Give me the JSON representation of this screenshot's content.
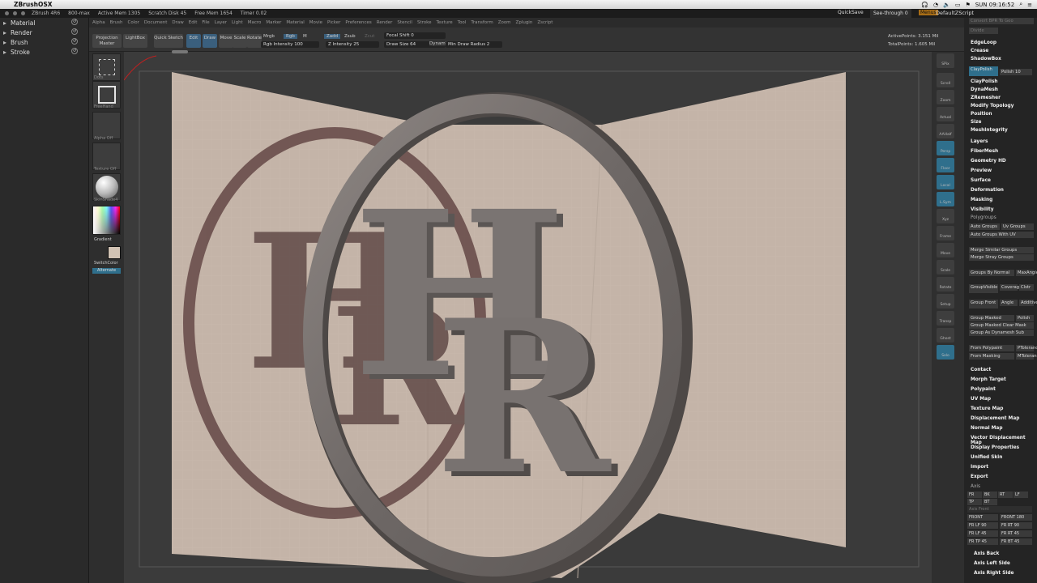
{
  "macbar": {
    "app_name": "ZBrushOSX",
    "clock": "SUN 09:16:52"
  },
  "statusbar": {
    "version": "ZBrush 4R6",
    "mem": "800-max",
    "active_mem": "Active Mem 1305",
    "scratch": "Scratch Disk 45",
    "free_mem": "Free Mem 1654",
    "timer": "Timer 0.02",
    "quicksave": "QuickSave",
    "see_through": "See-through  0",
    "menus": "Menus",
    "default_script": "DefaultZScript"
  },
  "leftpanel": {
    "items": [
      {
        "label": "Material"
      },
      {
        "label": "Render"
      },
      {
        "label": "Brush"
      },
      {
        "label": "Stroke"
      }
    ]
  },
  "topmenu": [
    "Alpha",
    "Brush",
    "Color",
    "Document",
    "Draw",
    "Edit",
    "File",
    "Layer",
    "Light",
    "Macro",
    "Marker",
    "Material",
    "Movie",
    "Picker",
    "Preferences",
    "Render",
    "Stencil",
    "Stroke",
    "Texture",
    "Tool",
    "Transform",
    "Zoom",
    "Zplugin",
    "Zscript"
  ],
  "toolbar": {
    "projection_master": "Projection Master",
    "lightbox": "LightBox",
    "quick_sketch": "Quick Sketch",
    "edit": "Edit",
    "draw": "Draw",
    "move": "Move",
    "scale": "Scale",
    "rotate": "Rotate",
    "mrgb": "Mrgb",
    "rgb": "Rgb",
    "m": "M",
    "rgb_intensity": "Rgb Intensity 100",
    "zadd": "Zadd",
    "zsub": "Zsub",
    "zcut": "Zcut",
    "z_intensity": "Z Intensity 25",
    "focal_shift": "Focal Shift 0",
    "draw_size": "Draw Size 64",
    "dynamic": "Dynamic",
    "min_draw_radius": "Min Draw Radius 2",
    "active_points": "ActivePoints: 3.151 Mil",
    "total_points": "TotalPoints: 1.605 Mil"
  },
  "lefttools": {
    "dots": "Dots",
    "free_hand": "FreeHand",
    "alpha_off": "Alpha Off",
    "texture_off": "Texture Off",
    "material": "SkinShade4",
    "gradient": "Gradient",
    "switch_color": "SwitchColor",
    "alternate": "Alternate"
  },
  "rightstrip": {
    "items": [
      "SPix",
      "Scroll",
      "Zoom",
      "Actual",
      "AAHalf",
      "Persp",
      "Floor",
      "Local",
      "L.Sym",
      "Xyz",
      "Frame",
      "Move",
      "Scale",
      "Rotate",
      "Setup",
      "Transp",
      "Ghost",
      "Solo"
    ]
  },
  "rightpanel": {
    "top": [
      "Convert BPR To Geo",
      "Divide",
      "Sm",
      "EdgeLoop",
      "Crease",
      "ShadowBox",
      "ClayPolish",
      "Polish 10",
      "DynaMesh",
      "ZRemesher",
      "Modify Topology",
      "Position",
      "Size",
      "MeshIntegrity"
    ],
    "sections": [
      "Layers",
      "FiberMesh",
      "Geometry HD",
      "Preview",
      "Surface",
      "Deformation",
      "Masking",
      "Visibility"
    ],
    "polygroups_title": "Polygroups",
    "polygroups": [
      "Auto Groups",
      "Uv Groups",
      "Auto Groups With UV",
      "Merge Similar Groups",
      "Merge Stray Groups",
      "Groups By Normal",
      "MaxAngle",
      "GroupVisible",
      "Coverage",
      "Clstr",
      "Group Front",
      "Angle",
      "Additive",
      "Group Masked",
      "Polish",
      "Group Masked Clear Mask",
      "Group As Dynamesh Sub",
      "From Polypaint",
      "PTolerance",
      "From Masking",
      "MTolerance"
    ],
    "sections2": [
      "Contact",
      "Morph Target",
      "Polypaint",
      "UV Map",
      "Texture Map",
      "Displacement Map",
      "Normal Map",
      "Vector Displacement Map",
      "Display Properties",
      "Unified Skin",
      "Import",
      "Export"
    ],
    "axis_title": "Axis",
    "axis": [
      "FR",
      "BK",
      "RT",
      "LF",
      "TP",
      "BT",
      "Axis Front",
      "FRONT",
      "FRONT 180",
      "FR LF 90",
      "FR RT 90",
      "FR LF 45",
      "FR RT 45",
      "FR TP 45",
      "FR BT 45",
      "Axis Back",
      "Axis Left Side",
      "Axis Right Side"
    ]
  },
  "canvas_text": {
    "h": "H",
    "r": "R"
  }
}
